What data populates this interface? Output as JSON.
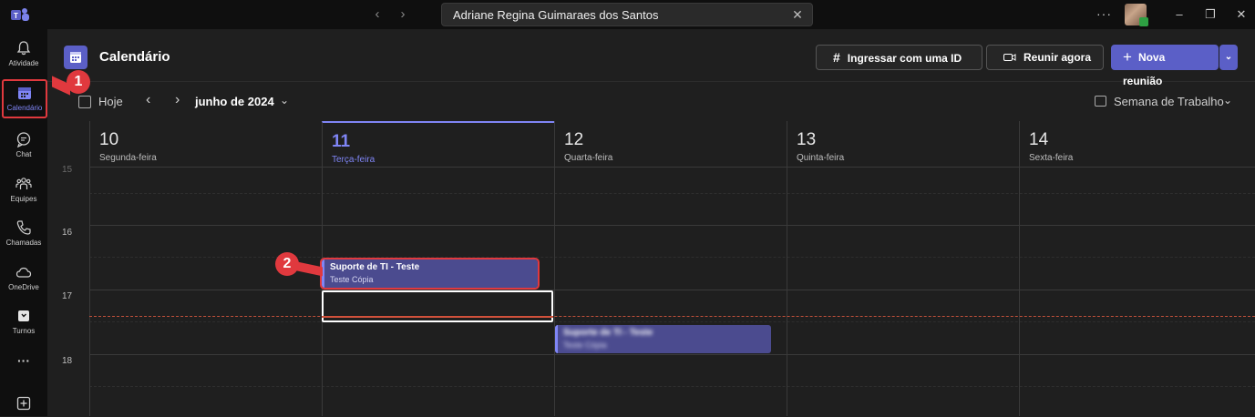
{
  "titlebar": {
    "search_text": "Adriane Regina Guimaraes dos Santos",
    "more": "···"
  },
  "rail": {
    "items": [
      {
        "label": "Atividade"
      },
      {
        "label": "Calendário"
      },
      {
        "label": "Chat"
      },
      {
        "label": "Equipes"
      },
      {
        "label": "Chamadas"
      },
      {
        "label": "OneDrive"
      },
      {
        "label": "Turnos"
      }
    ],
    "more": "···"
  },
  "header": {
    "title": "Calendário",
    "join_id": "Ingressar com uma ID",
    "meet_now": "Reunir agora",
    "new_meeting": "Nova reunião"
  },
  "toolbar": {
    "today": "Hoje",
    "month": "junho de 2024",
    "view": "Semana de Trabalho"
  },
  "days": [
    {
      "num": "10",
      "name": "Segunda-feira"
    },
    {
      "num": "11",
      "name": "Terça-feira"
    },
    {
      "num": "12",
      "name": "Quarta-feira"
    },
    {
      "num": "13",
      "name": "Quinta-feira"
    },
    {
      "num": "14",
      "name": "Sexta-feira"
    }
  ],
  "hours": [
    "15",
    "16",
    "17",
    "18"
  ],
  "events": [
    {
      "title": "Suporte de TI - Teste",
      "subtitle": "Teste Cópia"
    },
    {
      "title": "Suporte de TI - Teste",
      "subtitle": "Teste Cópia"
    }
  ],
  "callouts": [
    "1",
    "2"
  ],
  "colors": {
    "accent": "#5b5fc7",
    "accent_text": "#7f85f5",
    "highlight_red": "#e0393e"
  }
}
